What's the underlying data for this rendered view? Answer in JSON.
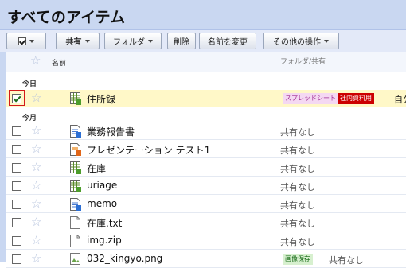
{
  "title": "すべてのアイテム",
  "toolbar": {
    "share": "共有",
    "folder": "フォルダ",
    "delete": "削除",
    "rename": "名前を変更",
    "more": "その他の操作"
  },
  "header": {
    "name": "名前",
    "share": "フォルダ/共有"
  },
  "groups": {
    "today": "今日",
    "month": "今月"
  },
  "rows": [
    {
      "name": "住所録",
      "icon": "spreadsheet-icon",
      "selected": true,
      "tags": [
        "スプレッドシート",
        "社内資料用"
      ],
      "owner": "自分"
    },
    {
      "name": "業務報告書",
      "icon": "document-icon",
      "share": "共有なし"
    },
    {
      "name": "プレゼンテーション テスト1",
      "icon": "presentation-icon",
      "share": "共有なし"
    },
    {
      "name": "在庫",
      "icon": "spreadsheet-icon",
      "share": "共有なし"
    },
    {
      "name": "uriage",
      "icon": "spreadsheet-icon",
      "share": "共有なし"
    },
    {
      "name": "memo",
      "icon": "document-icon",
      "share": "共有なし"
    },
    {
      "name": "在庫.txt",
      "icon": "file-icon",
      "share": "共有なし"
    },
    {
      "name": "img.zip",
      "icon": "file-icon",
      "share": "共有なし"
    },
    {
      "name": "032_kingyo.png",
      "icon": "image-icon",
      "tags": [
        "画像保存"
      ],
      "share": "共有なし"
    }
  ],
  "colors": {
    "titlebar": "#c9d7f1",
    "selected_row": "#fff8c8",
    "tag_red": "#cc0000"
  }
}
